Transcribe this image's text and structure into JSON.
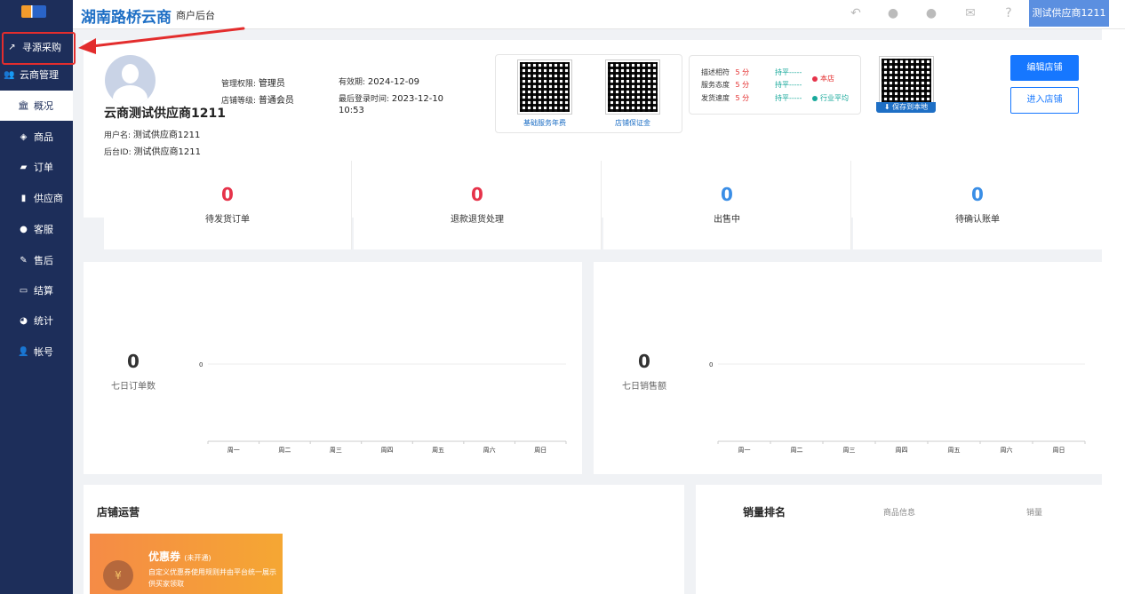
{
  "sidebar": {
    "items": [
      {
        "label": "寻源采购",
        "icon": "external-link-icon"
      },
      {
        "label": "云商管理",
        "icon": "users-icon"
      },
      {
        "label": "概况",
        "icon": "bank-icon"
      },
      {
        "label": "商品",
        "icon": "cube-icon"
      },
      {
        "label": "订单",
        "icon": "book-icon"
      },
      {
        "label": "供应商",
        "icon": "building-icon"
      },
      {
        "label": "客服",
        "icon": "comments-icon"
      },
      {
        "label": "售后",
        "icon": "wrench-icon"
      },
      {
        "label": "结算",
        "icon": "credit-card-icon"
      },
      {
        "label": "统计",
        "icon": "pie-chart-icon"
      },
      {
        "label": "帐号",
        "icon": "user-group-icon"
      }
    ]
  },
  "header": {
    "brand": "湖南路桥云商",
    "subtitle": "商户后台",
    "user": "测试供应商1211"
  },
  "profile": {
    "store_name": "云商测试供应商1211",
    "username_label": "用户名:",
    "username": "测试供应商1211",
    "admin_id_label": "后台ID:",
    "admin_id": "测试供应商1211",
    "permission_label": "管理权限:",
    "permission": "管理员",
    "level_label": "店铺等级:",
    "level": "普通会员",
    "valid_label": "有效期:",
    "valid": "2024-12-09",
    "last_login_label": "最后登录时间:",
    "last_login": "2023-12-10",
    "last_login_time": "10:53"
  },
  "qr": {
    "annual_fee": "基础服务年费",
    "deposit": "店铺保证金",
    "save_local": "保存到本地"
  },
  "scores": {
    "rows": [
      {
        "label": "描述相符",
        "score": "5 分",
        "compare": "持平-----"
      },
      {
        "label": "服务态度",
        "score": "5 分",
        "compare": "持平-----"
      },
      {
        "label": "发货速度",
        "score": "5 分",
        "compare": "持平-----"
      }
    ],
    "legend_store": "本店",
    "legend_industry": "行业平均"
  },
  "buttons": {
    "edit_store": "编辑店铺",
    "enter_store": "进入店铺"
  },
  "stats": [
    {
      "value": "0",
      "label": "待发货订单",
      "color": "#e6334a"
    },
    {
      "value": "0",
      "label": "退款退货处理",
      "color": "#e6334a"
    },
    {
      "value": "0",
      "label": "出售中",
      "color": "#3a8ee6"
    },
    {
      "value": "0",
      "label": "待确认账单",
      "color": "#3a8ee6"
    }
  ],
  "chart_data": [
    {
      "type": "line",
      "categories": [
        "周一",
        "周二",
        "周三",
        "周四",
        "周五",
        "周六",
        "周日"
      ],
      "values": [
        0,
        0,
        0,
        0,
        0,
        0,
        0
      ],
      "total": "0",
      "total_label": "七日订单数",
      "y_tick": "0"
    },
    {
      "type": "line",
      "categories": [
        "周一",
        "周二",
        "周三",
        "周四",
        "周五",
        "周六",
        "周日"
      ],
      "values": [
        0,
        0,
        0,
        0,
        0,
        0,
        0
      ],
      "total": "0",
      "total_label": "七日销售额",
      "y_tick": "0"
    }
  ],
  "operations": {
    "title": "店铺运营",
    "coupon_title": "优惠券",
    "coupon_status": "(未开通)",
    "coupon_desc": "自定义优惠券使用规则并由平台统一展示供买家领取",
    "coupon_icon_char": "¥"
  },
  "ranking": {
    "title": "销量排名",
    "col_product": "商品信息",
    "col_sales": "销量"
  }
}
